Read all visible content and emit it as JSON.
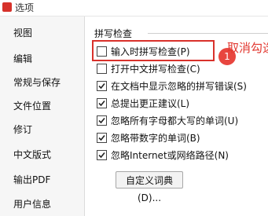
{
  "window": {
    "title": "选项"
  },
  "sidebar": {
    "items": [
      {
        "label": "视图"
      },
      {
        "label": "编辑"
      },
      {
        "label": "常规与保存"
      },
      {
        "label": "文件位置"
      },
      {
        "label": "修订"
      },
      {
        "label": "中文版式"
      },
      {
        "label": "输出PDF"
      },
      {
        "label": "用户信息"
      }
    ]
  },
  "spelling": {
    "group_title": "拼写检查",
    "options": [
      {
        "label": "输入时拼写检查(P)",
        "checked": false
      },
      {
        "label": "打开中文拼写检查(C)",
        "checked": false
      },
      {
        "label": "在文档中显示忽略的拼写错误(S)",
        "checked": true
      },
      {
        "label": "总提出更正建议(L)",
        "checked": true
      },
      {
        "label": "忽略所有字母都大写的单词(U)",
        "checked": true
      },
      {
        "label": "忽略带数字的单词(B)",
        "checked": true
      },
      {
        "label": "忽略Internet或网络路径(N)",
        "checked": true
      }
    ],
    "custom_dict_button": "自定义词典(D)..."
  },
  "annotation": {
    "step_number": "1",
    "callout_text": "取消勾选",
    "color": "#e2372f"
  }
}
